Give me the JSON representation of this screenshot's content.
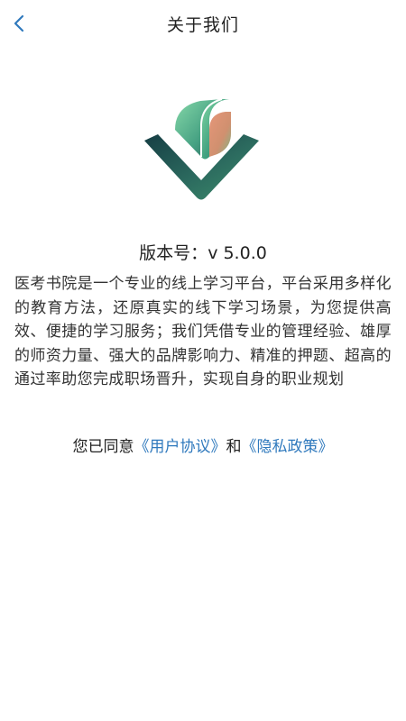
{
  "header": {
    "title": "关于我们",
    "back_icon": "chevron-left-icon"
  },
  "logo": {
    "icon": "app-logo",
    "colors": {
      "dark": "#1f4d4a",
      "mid": "#2e8a70",
      "light": "#5fbf8f",
      "accent": "#d98a72"
    }
  },
  "about": {
    "version_label": "版本号：",
    "version_value": "v 5.0.0",
    "description": "医考书院是一个专业的线上学习平台，平台采用多样化的教育方法，还原真实的线下学习场景，为您提供高效、便捷的学习服务；我们凭借专业的管理经验、雄厚的师资力量、强大的品牌影响力、精准的押题、超高的通过率助您完成职场晋升，实现自身的职业规划"
  },
  "agreement": {
    "prefix": "您已同意",
    "user_agreement": "《用户协议》",
    "conjunction": "和",
    "privacy_policy": "《隐私政策》",
    "link_color": "#2f79bd"
  }
}
